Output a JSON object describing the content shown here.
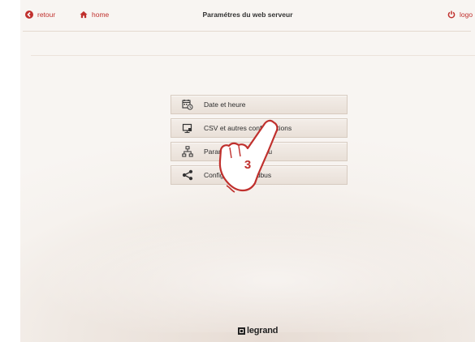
{
  "header": {
    "back_label": "retour",
    "home_label": "home",
    "title": "Paramétres du web serveur",
    "logout_label": "logo"
  },
  "menu": {
    "items": [
      {
        "label": "Date et heure",
        "icon": "calendar-clock-icon"
      },
      {
        "label": "CSV et autres configurations",
        "icon": "monitor-icon"
      },
      {
        "label": "Paramètres de réseau",
        "icon": "network-icon"
      },
      {
        "label": "Configuration Modbus",
        "icon": "share-icon"
      }
    ]
  },
  "callout": {
    "step_number": "3"
  },
  "footer": {
    "brand": "legrand"
  },
  "colors": {
    "accent": "#c0302d",
    "background": "#f6f2ee",
    "button": "#ece4dc"
  }
}
